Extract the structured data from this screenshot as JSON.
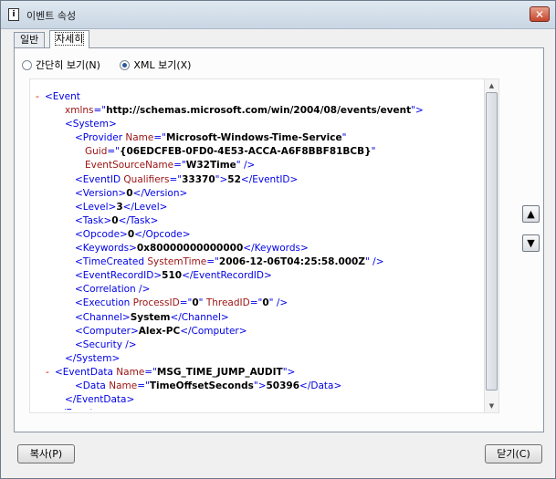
{
  "window": {
    "title": "이벤트 속성",
    "icon": "event-doc-icon",
    "close_glyph": "✕"
  },
  "tabs": [
    {
      "label": "일반",
      "active": false
    },
    {
      "label": "자세히",
      "active": true
    }
  ],
  "view_options": {
    "friendly": "간단히 보기(N)",
    "xml": "XML 보기(X)",
    "selected": "xml"
  },
  "xml": {
    "lines": [
      {
        "indent": 0,
        "collapse": "-",
        "parts": [
          [
            "tag",
            "<Event"
          ]
        ]
      },
      {
        "indent": 2,
        "parts": [
          [
            "attr",
            "xmlns"
          ],
          [
            "tag",
            "=\""
          ],
          [
            "val",
            "http://schemas.microsoft.com/win/2004/08/events/event"
          ],
          [
            "tag",
            "\">"
          ]
        ]
      },
      {
        "indent": 2,
        "parts": [
          [
            "tag",
            "<System>"
          ]
        ]
      },
      {
        "indent": 3,
        "parts": [
          [
            "tag",
            "<Provider "
          ],
          [
            "attr",
            "Name"
          ],
          [
            "tag",
            "=\""
          ],
          [
            "val",
            "Microsoft-Windows-Time-Service"
          ],
          [
            "tag",
            "\""
          ]
        ]
      },
      {
        "indent": 4,
        "parts": [
          [
            "attr",
            "Guid"
          ],
          [
            "tag",
            "=\""
          ],
          [
            "val",
            "{06EDCFEB-0FD0-4E53-ACCA-A6F8BBF81BCB}"
          ],
          [
            "tag",
            "\""
          ]
        ]
      },
      {
        "indent": 4,
        "parts": [
          [
            "attr",
            "EventSourceName"
          ],
          [
            "tag",
            "=\""
          ],
          [
            "val",
            "W32Time"
          ],
          [
            "tag",
            "\" />"
          ]
        ]
      },
      {
        "indent": 3,
        "parts": [
          [
            "tag",
            "<EventID "
          ],
          [
            "attr",
            "Qualifiers"
          ],
          [
            "tag",
            "=\""
          ],
          [
            "val",
            "33370"
          ],
          [
            "tag",
            "\">"
          ],
          [
            "val",
            "52"
          ],
          [
            "tag",
            "</EventID>"
          ]
        ]
      },
      {
        "indent": 3,
        "parts": [
          [
            "tag",
            "<Version>"
          ],
          [
            "val",
            "0"
          ],
          [
            "tag",
            "</Version>"
          ]
        ]
      },
      {
        "indent": 3,
        "parts": [
          [
            "tag",
            "<Level>"
          ],
          [
            "val",
            "3"
          ],
          [
            "tag",
            "</Level>"
          ]
        ]
      },
      {
        "indent": 3,
        "parts": [
          [
            "tag",
            "<Task>"
          ],
          [
            "val",
            "0"
          ],
          [
            "tag",
            "</Task>"
          ]
        ]
      },
      {
        "indent": 3,
        "parts": [
          [
            "tag",
            "<Opcode>"
          ],
          [
            "val",
            "0"
          ],
          [
            "tag",
            "</Opcode>"
          ]
        ]
      },
      {
        "indent": 3,
        "parts": [
          [
            "tag",
            "<Keywords>"
          ],
          [
            "val",
            "0x80000000000000"
          ],
          [
            "tag",
            "</Keywords>"
          ]
        ]
      },
      {
        "indent": 3,
        "parts": [
          [
            "tag",
            "<TimeCreated "
          ],
          [
            "attr",
            "SystemTime"
          ],
          [
            "tag",
            "=\""
          ],
          [
            "val",
            "2006-12-06T04:25:58.000Z"
          ],
          [
            "tag",
            "\" />"
          ]
        ]
      },
      {
        "indent": 3,
        "parts": [
          [
            "tag",
            "<EventRecordID>"
          ],
          [
            "val",
            "510"
          ],
          [
            "tag",
            "</EventRecordID>"
          ]
        ]
      },
      {
        "indent": 3,
        "parts": [
          [
            "tag",
            "<Correlation />"
          ]
        ]
      },
      {
        "indent": 3,
        "parts": [
          [
            "tag",
            "<Execution "
          ],
          [
            "attr",
            "ProcessID"
          ],
          [
            "tag",
            "=\""
          ],
          [
            "val",
            "0"
          ],
          [
            "tag",
            "\" "
          ],
          [
            "attr",
            "ThreadID"
          ],
          [
            "tag",
            "=\""
          ],
          [
            "val",
            "0"
          ],
          [
            "tag",
            "\" />"
          ]
        ]
      },
      {
        "indent": 3,
        "parts": [
          [
            "tag",
            "<Channel>"
          ],
          [
            "val",
            "System"
          ],
          [
            "tag",
            "</Channel>"
          ]
        ]
      },
      {
        "indent": 3,
        "parts": [
          [
            "tag",
            "<Computer>"
          ],
          [
            "val",
            "Alex-PC"
          ],
          [
            "tag",
            "</Computer>"
          ]
        ]
      },
      {
        "indent": 3,
        "parts": [
          [
            "tag",
            "<Security />"
          ]
        ]
      },
      {
        "indent": 2,
        "parts": [
          [
            "tag",
            "</System>"
          ]
        ]
      },
      {
        "indent": 1,
        "collapse": "-",
        "parts": [
          [
            "tag",
            "<EventData "
          ],
          [
            "attr",
            "Name"
          ],
          [
            "tag",
            "=\""
          ],
          [
            "val",
            "MSG_TIME_JUMP_AUDIT"
          ],
          [
            "tag",
            "\">"
          ]
        ]
      },
      {
        "indent": 3,
        "parts": [
          [
            "tag",
            "<Data "
          ],
          [
            "attr",
            "Name"
          ],
          [
            "tag",
            "=\""
          ],
          [
            "val",
            "TimeOffsetSeconds"
          ],
          [
            "tag",
            "\">"
          ],
          [
            "val",
            "50396"
          ],
          [
            "tag",
            "</Data>"
          ]
        ]
      },
      {
        "indent": 2,
        "parts": [
          [
            "tag",
            "</EventData>"
          ]
        ]
      },
      {
        "indent": 1,
        "parts": [
          [
            "tag",
            "</Event>"
          ]
        ]
      }
    ]
  },
  "side_buttons": {
    "up_icon": "arrow-up-icon",
    "up_glyph": "▲",
    "down_icon": "arrow-down-icon",
    "down_glyph": "▼"
  },
  "buttons": {
    "copy": "복사(P)",
    "close": "닫기(C)"
  },
  "colors": {
    "tag": "#0000e6",
    "attr": "#9b1212",
    "value": "#000000",
    "collapse": "#e10000"
  }
}
